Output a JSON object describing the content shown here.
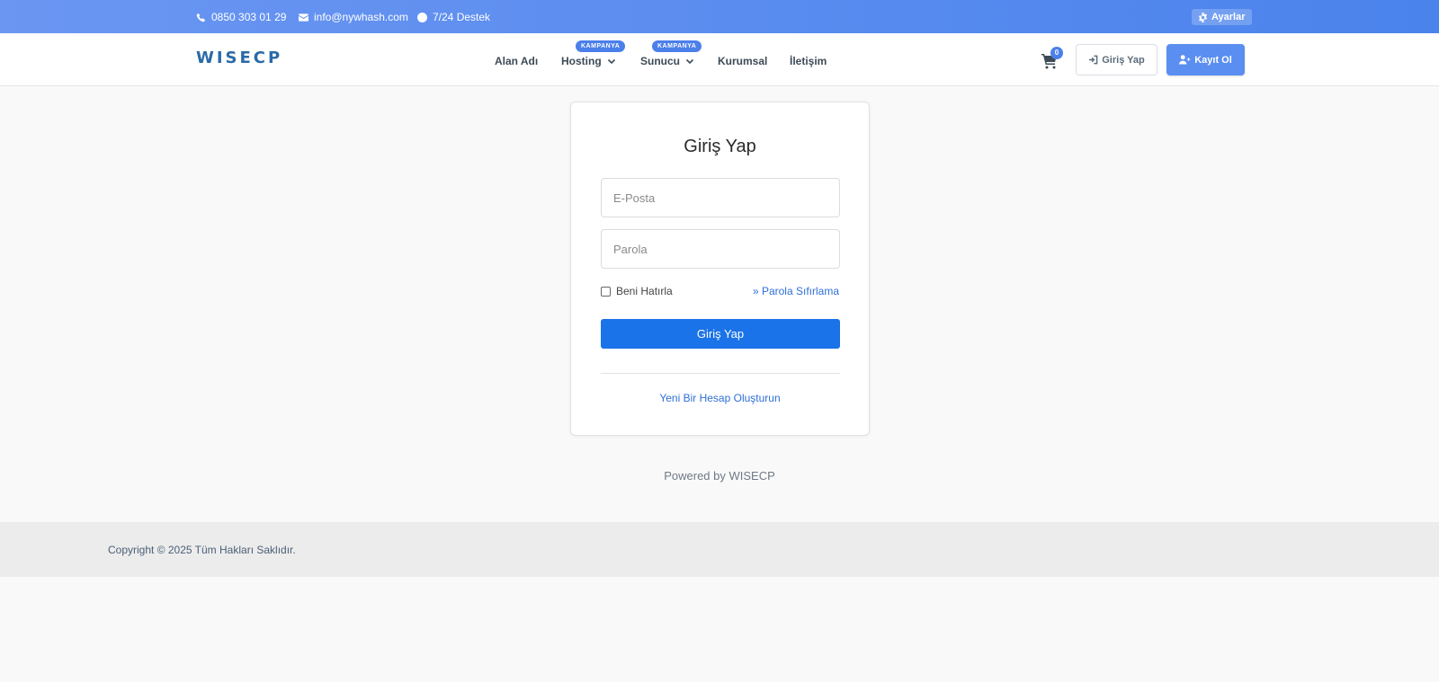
{
  "topbar": {
    "phone": "0850 303 01 29",
    "email": "info@nywhash.com",
    "support": "7/24 Destek",
    "settings_label": "Ayarlar"
  },
  "header": {
    "logo_text_a": "WIS",
    "logo_text_b": "ECP",
    "nav": [
      {
        "label": "Alan Adı"
      },
      {
        "label": "Hosting",
        "badge": "KAMPANYA"
      },
      {
        "label": "Sunucu",
        "badge": "KAMPANYA"
      },
      {
        "label": "Kurumsal"
      },
      {
        "label": "İletişim"
      }
    ],
    "cart_count": "0",
    "login_label": "Giriş Yap",
    "register_label": "Kayıt Ol"
  },
  "login": {
    "title": "Giriş Yap",
    "email_placeholder": "E-Posta",
    "password_placeholder": "Parola",
    "remember_label": "Beni Hatırla",
    "reset_label": "» Parola Sıfırlama",
    "submit_label": "Giriş Yap",
    "create_account_label": "Yeni Bir Hesap Oluşturun"
  },
  "powered_by": "Powered by WISECP",
  "footer": {
    "copyright": "Copyright © 2025 Tüm Hakları Saklıdır."
  },
  "colors": {
    "topbar": "#4a83ec",
    "accent": "#1a73e8",
    "register": "#5a8ef0",
    "badge": "#4b7fea"
  }
}
